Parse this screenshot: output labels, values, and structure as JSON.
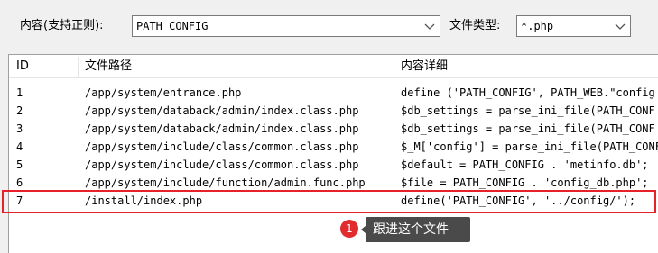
{
  "search": {
    "content_label": "内容(支持正则):",
    "content_value": "PATH_CONFIG",
    "filetype_label": "文件类型:",
    "filetype_value": "*.php"
  },
  "table": {
    "columns": [
      "ID",
      "文件路径",
      "内容详细"
    ],
    "rows": [
      {
        "id": "1",
        "path": "/app/system/entrance.php",
        "detail": "define ('PATH_CONFIG', PATH_WEB.\"config"
      },
      {
        "id": "2",
        "path": "/app/system/databack/admin/index.class.php",
        "detail": "$db_settings = parse_ini_file(PATH_CONF"
      },
      {
        "id": "3",
        "path": "/app/system/databack/admin/index.class.php",
        "detail": "$db_settings = parse_ini_file(PATH_CONF"
      },
      {
        "id": "4",
        "path": "/app/system/include/class/common.class.php",
        "detail": "$_M['config'] = parse_ini_file(PATH_CONF"
      },
      {
        "id": "5",
        "path": "/app/system/include/class/common.class.php",
        "detail": "$default = PATH_CONFIG . 'metinfo.db';"
      },
      {
        "id": "6",
        "path": "/app/system/include/function/admin.func.php",
        "detail": "$file = PATH_CONFIG . 'config_db.php';"
      },
      {
        "id": "7",
        "path": "/install/index.php",
        "detail": "define('PATH_CONFIG', '../config/');"
      }
    ]
  },
  "annotation": {
    "number": "1",
    "text": "跟进这个文件",
    "highlight_color": "#e8202a"
  }
}
